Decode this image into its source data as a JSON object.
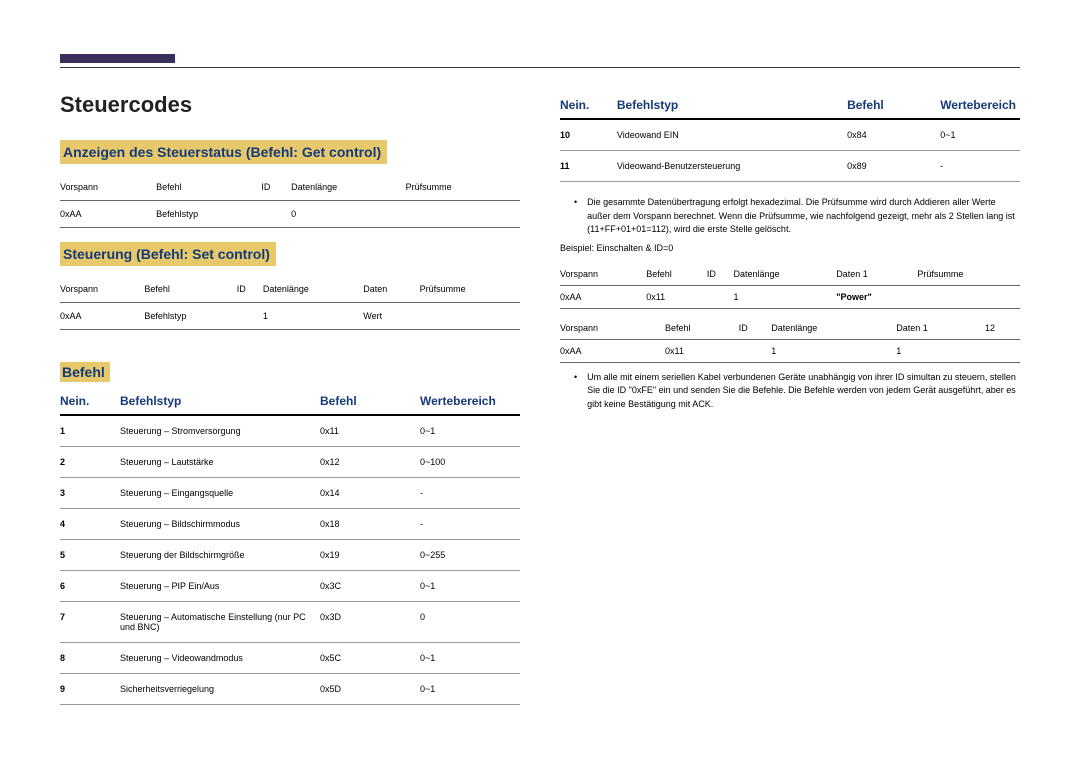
{
  "header": {
    "title": "Steuercodes"
  },
  "left": {
    "sec1": {
      "heading": "Anzeigen des Steuerstatus (Befehl: Get control)",
      "headers": [
        "Vorspann",
        "Befehl",
        "ID",
        "Datenlänge",
        "Prüfsumme"
      ],
      "row": [
        "0xAA",
        "Befehlstyp",
        "",
        "0",
        ""
      ]
    },
    "sec2": {
      "heading": "Steuerung (Befehl: Set control)",
      "headers": [
        "Vorspann",
        "Befehl",
        "ID",
        "Datenlänge",
        "Daten",
        "Prüfsumme"
      ],
      "row": [
        "0xAA",
        "Befehlstyp",
        "",
        "1",
        "Wert",
        ""
      ]
    },
    "cmd": {
      "heading": "Befehl",
      "headers": [
        "Nein.",
        "Befehlstyp",
        "Befehl",
        "Wertebereich"
      ],
      "rows": [
        [
          "1",
          "Steuerung – Stromversorgung",
          "0x11",
          "0~1"
        ],
        [
          "2",
          "Steuerung – Lautstärke",
          "0x12",
          "0~100"
        ],
        [
          "3",
          "Steuerung – Eingangsquelle",
          "0x14",
          "-"
        ],
        [
          "4",
          "Steuerung – Bildschirmmodus",
          "0x18",
          "-"
        ],
        [
          "5",
          "Steuerung der Bildschirmgröße",
          "0x19",
          "0~255"
        ],
        [
          "6",
          "Steuerung – PIP Ein/Aus",
          "0x3C",
          "0~1"
        ],
        [
          "7",
          "Steuerung – Automatische Einstellung (nur PC und BNC)",
          "0x3D",
          "0"
        ],
        [
          "8",
          "Steuerung – Videowandmodus",
          "0x5C",
          "0~1"
        ],
        [
          "9",
          "Sicherheitsverriegelung",
          "0x5D",
          "0~1"
        ]
      ]
    }
  },
  "right": {
    "cmd": {
      "headers": [
        "Nein.",
        "Befehlstyp",
        "Befehl",
        "Wertebereich"
      ],
      "rows": [
        [
          "10",
          "Videowand EIN",
          "0x84",
          "0~1"
        ],
        [
          "11",
          "Videowand-Benutzersteuerung",
          "0x89",
          "-"
        ]
      ]
    },
    "bullet1": "Die gesammte Datenübertragung erfolgt hexadezimal. Die Prüfsumme wird durch Addieren aller Werte außer dem Vorspann berechnet. Wenn die Prüfsumme, wie nachfolgend gezeigt, mehr als 2 Stellen lang ist (11+FF+01+01=112), wird die erste Stelle gelöscht.",
    "example_label": "Beispiel: Einschalten & ID=0",
    "ptable1": {
      "headers": [
        "Vorspann",
        "Befehl",
        "ID",
        "Datenlänge",
        "Daten 1",
        "Prüfsumme"
      ],
      "row": [
        "0xAA",
        "0x11",
        "",
        "1",
        "\"Power\"",
        ""
      ]
    },
    "ptable2": {
      "headers": [
        "Vorspann",
        "Befehl",
        "ID",
        "Datenlänge",
        "Daten 1",
        "12"
      ],
      "row": [
        "0xAA",
        "0x11",
        "",
        "1",
        "1",
        ""
      ]
    },
    "bullet2": "Um alle mit einem seriellen Kabel verbundenen Geräte unabhängig von ihrer ID simultan zu steuern, stellen Sie die ID \"0xFE\" ein und senden Sie die Befehle. Die Befehle werden von jedem Gerät ausgeführt, aber es gibt keine Bestätigung mit ACK."
  }
}
